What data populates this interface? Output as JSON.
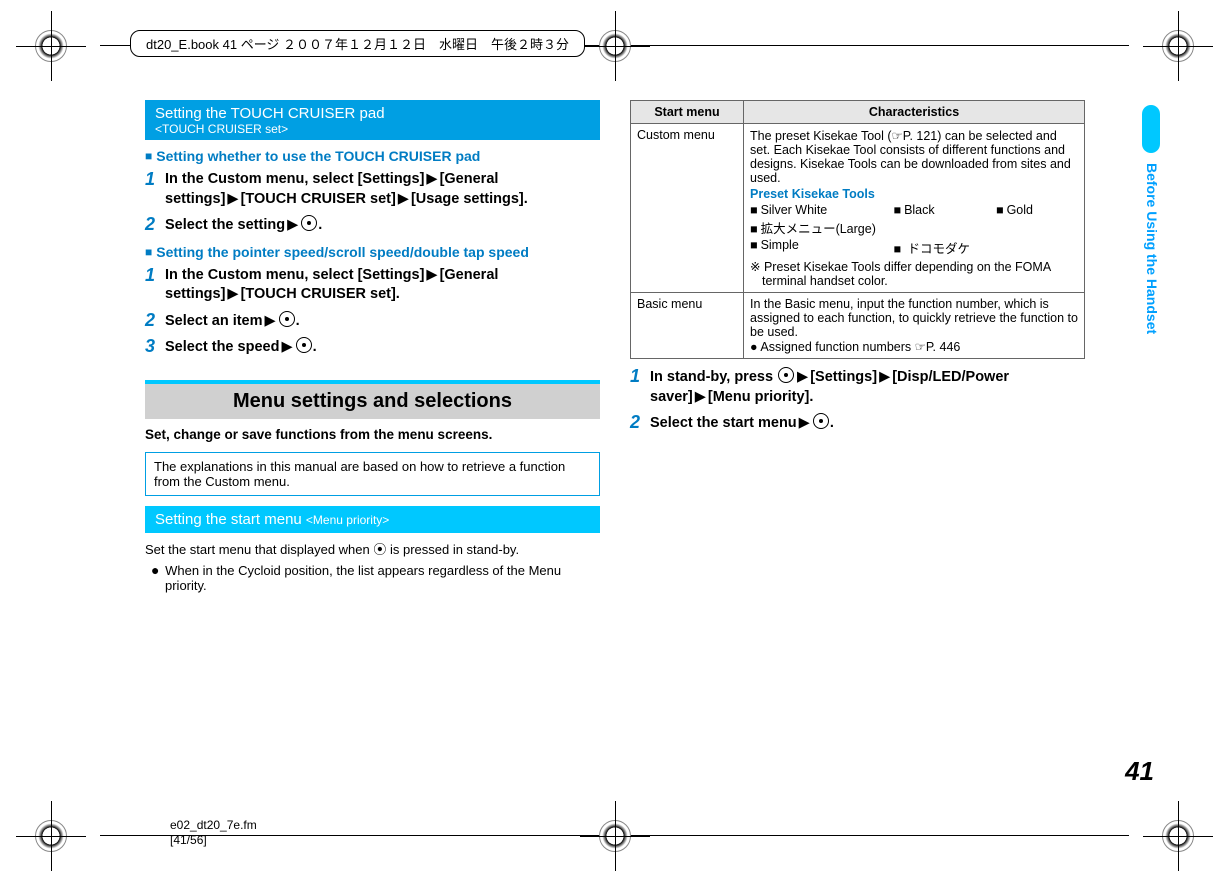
{
  "top_label": "dt20_E.book  41 ページ  ２００７年１２月１２日　水曜日　午後２時３分",
  "side_tab": "Before Using the Handset",
  "page_number": "41",
  "footer_line1": "e02_dt20_7e.fm",
  "footer_line2": "[41/56]",
  "left": {
    "header_title": "Setting the TOUCH CRUISER pad",
    "header_sub": "<TOUCH CRUISER set>",
    "sec1_title": "Setting whether to use the TOUCH CRUISER pad",
    "sec1_step1_a": "In the Custom menu, select [Settings]",
    "sec1_step1_b": "[General settings]",
    "sec1_step1_c": "[TOUCH CRUISER set]",
    "sec1_step1_d": "[Usage settings].",
    "sec1_step2": "Select the setting",
    "sec2_title": "Setting the pointer speed/scroll speed/double tap speed",
    "sec2_step1_a": "In the Custom menu, select [Settings]",
    "sec2_step1_b": "[General settings]",
    "sec2_step1_c": "[TOUCH CRUISER set].",
    "sec2_step2": "Select an item",
    "sec2_step3": "Select the speed",
    "menu_title": "Menu settings and selections",
    "menu_intro": "Set, change or save functions from the menu screens.",
    "note": "The explanations in this manual are based on how to retrieve a function from the Custom menu.",
    "start_menu_title": "Setting the start menu",
    "start_menu_sub": "<Menu priority>",
    "start_menu_text": "Set the start menu that displayed when ⦿ is pressed in stand-by.",
    "start_menu_bullet": "When in the Cycloid position, the list appears regardless of the Menu priority."
  },
  "right": {
    "th1": "Start menu",
    "th2": "Characteristics",
    "row1_label": "Custom menu",
    "row1_text": "The preset Kisekae Tool (☞P. 121) can be selected and set. Each Kisekae Tool consists of different functions and designs. Kisekae Tools can be downloaded from sites and used.",
    "preset_title": "Preset Kisekae Tools",
    "tools": {
      "t1": "Silver White",
      "t2": "Black",
      "t3": "Gold",
      "t4": "拡大メニュー(Large)",
      "t5": "Simple",
      "t6": "ドコモダケ"
    },
    "tools_note": "※ Preset Kisekae Tools differ depending on the FOMA terminal handset color.",
    "row2_label": "Basic menu",
    "row2_text": "In the Basic menu, input the function number, which is assigned to each function, to quickly retrieve the function to be used.",
    "row2_bullet": "Assigned function numbers ☞P. 446",
    "step1_a": "In stand-by, press",
    "step1_b": "[Settings]",
    "step1_c": "[Disp/LED/Power saver]",
    "step1_d": "[Menu priority].",
    "step2": "Select the start menu"
  }
}
